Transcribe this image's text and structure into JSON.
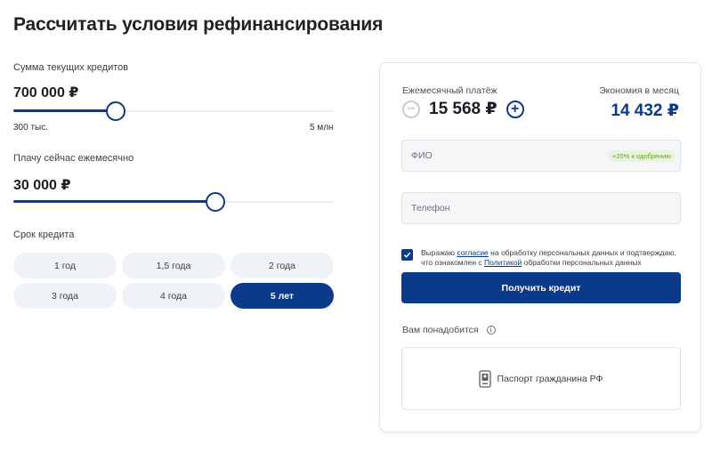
{
  "title": "Рассчитать условия рефинансирования",
  "amount": {
    "label": "Сумма текущих кредитов",
    "value": "700 000 ₽",
    "min_label": "300 тыс.",
    "max_label": "5 млн",
    "slider_fraction": 0.32
  },
  "payment_now": {
    "label": "Плачу сейчас ежемесячно",
    "value": "30 000 ₽",
    "slider_fraction": 0.63
  },
  "term": {
    "label": "Срок кредита",
    "options": [
      "1 год",
      "1,5 года",
      "2 года",
      "3 года",
      "4 года",
      "5 лет"
    ],
    "selected": "5 лет"
  },
  "result": {
    "monthly_label": "Ежемесячный платёж",
    "monthly_value": "15 568 ₽",
    "economy_label": "Экономия в месяц",
    "economy_value": "14 432 ₽"
  },
  "form": {
    "fio_placeholder": "ФИО",
    "fio_badge": "+20% к одобрению",
    "phone_placeholder": "Телефон",
    "consent_part1": "Выражаю ",
    "consent_link1": "согласие",
    "consent_part2": " на обработку персональных данных и подтверждаю, что ознакомлен с ",
    "consent_link2": "Политикой",
    "consent_part3": " обработки персональных данных",
    "consent_checked": true,
    "submit_label": "Получить кредит"
  },
  "docs": {
    "label": "Вам понадобится",
    "info_symbol": "i",
    "item": "Паспорт гражданина РФ"
  },
  "colors": {
    "accent": "#0b3a8a",
    "badge_green": "#5fa32a",
    "chip_bg": "#eff2f6"
  },
  "icons": {
    "minus": "minus-circle-icon",
    "plus": "plus-circle-icon",
    "info": "info-icon",
    "passport": "passport-icon",
    "check": "checkmark-icon"
  }
}
